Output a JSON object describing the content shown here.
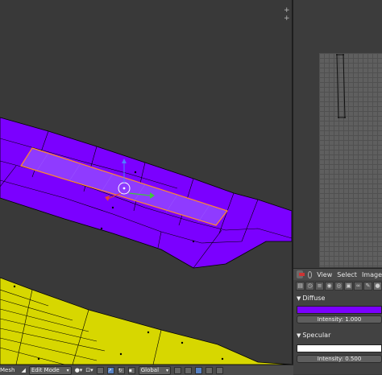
{
  "viewport": {
    "mesh_color": "#7b00ff",
    "selected_edge_color": "#ff8a2a",
    "ground_color": "#d7d700",
    "background_color": "#393939"
  },
  "uv_editor": {
    "corner_handle": "+ +"
  },
  "image_header": {
    "menus": [
      "View",
      "Select",
      "Image"
    ]
  },
  "properties": {
    "diffuse": {
      "title": "Diffuse",
      "color": "#7b00ff",
      "intensity_label": "Intensity: 1.000"
    },
    "specular": {
      "title": "Specular",
      "color": "#ffffff",
      "intensity_label": "Intensity: 0.500"
    }
  },
  "bottom_header": {
    "object_label": "Mesh",
    "mode": "Edit Mode",
    "orientation": "Global"
  }
}
